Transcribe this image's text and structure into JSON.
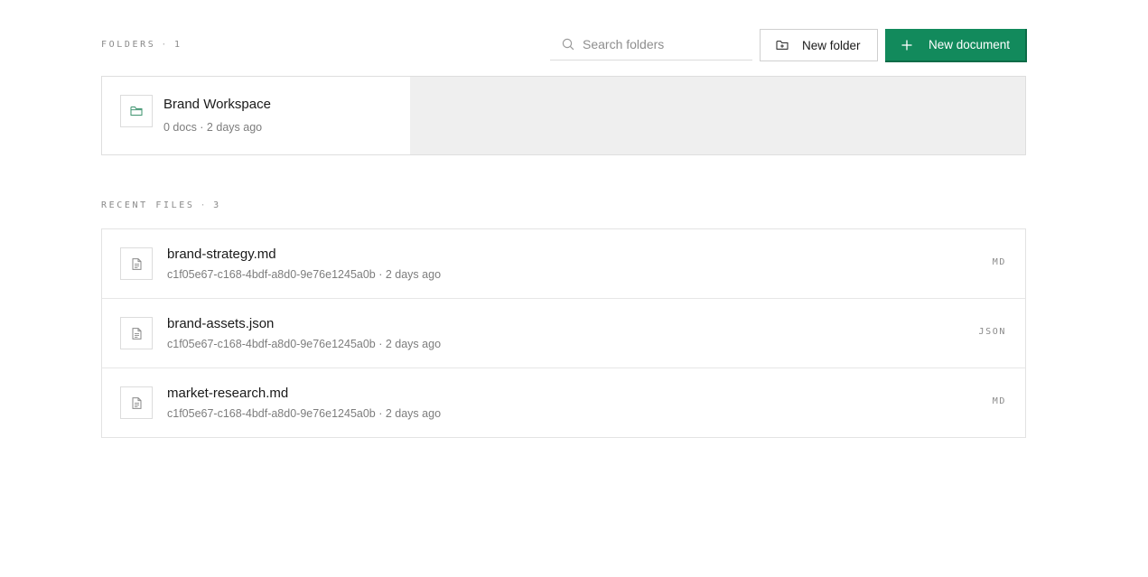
{
  "folders_section": {
    "label": "Folders",
    "separator": "·",
    "count": "1"
  },
  "search": {
    "placeholder": "Search folders",
    "value": ""
  },
  "toolbar": {
    "new_folder_label": "New folder",
    "new_document_label": "New document"
  },
  "folders": [
    {
      "name": "Brand Workspace",
      "meta": "0 docs · 2 days ago"
    }
  ],
  "recent_section": {
    "label": "Recent files",
    "separator": "·",
    "count": "3"
  },
  "files": [
    {
      "name": "brand-strategy.md",
      "meta": "c1f05e67-c168-4bdf-a8d0-9e76e1245a0b · 2 days ago",
      "type": "MD"
    },
    {
      "name": "brand-assets.json",
      "meta": "c1f05e67-c168-4bdf-a8d0-9e76e1245a0b · 2 days ago",
      "type": "JSON"
    },
    {
      "name": "market-research.md",
      "meta": "c1f05e67-c168-4bdf-a8d0-9e76e1245a0b · 2 days ago",
      "type": "MD"
    }
  ],
  "colors": {
    "accent": "#128a5c",
    "accent_dark": "#0c6b47",
    "border": "#dedede",
    "muted_text": "#7d7d7d",
    "empty_fill": "#efefef"
  },
  "icons": {
    "search": "search-icon",
    "new_folder": "folder-plus-icon",
    "new_document": "plus-icon",
    "folder": "folder-icon",
    "file": "file-icon"
  }
}
